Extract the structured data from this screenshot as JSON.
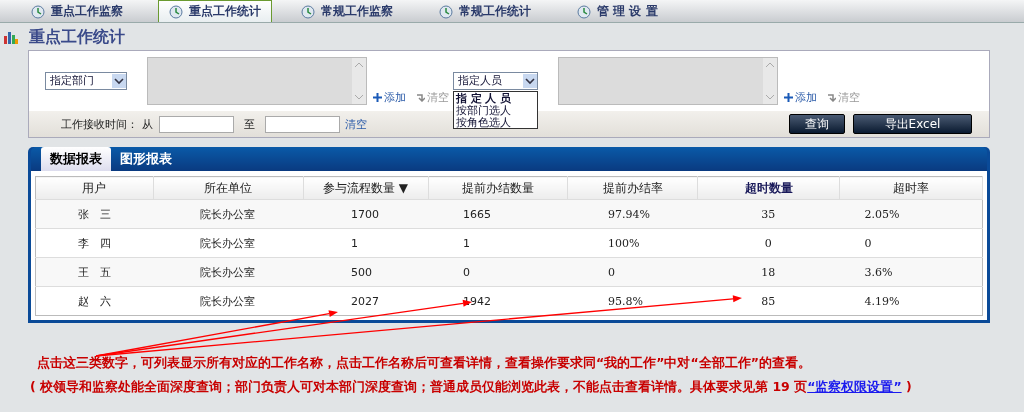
{
  "top_tabs": [
    {
      "label": "重点工作监察",
      "selected": false
    },
    {
      "label": "重点工作统计",
      "selected": true
    },
    {
      "label": "常规工作监察",
      "selected": false
    },
    {
      "label": "常规工作统计",
      "selected": false
    },
    {
      "label": "管 理 设 置",
      "selected": false
    }
  ],
  "page_title": "重点工作统计",
  "filters": {
    "pickers": [
      {
        "select": {
          "value": "指定部门"
        },
        "add": "添加",
        "clear": "清空"
      },
      {
        "select": {
          "value": "指定人员",
          "options": [
            {
              "label": "指 定 人 员",
              "selected": true
            },
            {
              "label": "按部门选人",
              "selected": false
            },
            {
              "label": "按角色选人",
              "selected": false
            }
          ]
        },
        "add": "添加",
        "clear": "清空"
      }
    ],
    "time_label": "工作接收时间：",
    "from": "从",
    "to": "至",
    "clear": "清空",
    "buttons": [
      "查询",
      "导出Excel"
    ]
  },
  "report_tabs": [
    {
      "label": "数据报表",
      "selected": true
    },
    {
      "label": "图形报表",
      "selected": false
    }
  ],
  "table": {
    "columns": [
      {
        "label": "用户"
      },
      {
        "label": "所在单位"
      },
      {
        "label": "参与流程数量",
        "sort_mark": "▼"
      },
      {
        "label": "提前办结数量"
      },
      {
        "label": "提前办结率"
      },
      {
        "label": "超时数量",
        "highlighted": true
      },
      {
        "label": "超时率"
      }
    ],
    "rows": [
      [
        "张　三",
        "院长办公室",
        "1700",
        "1665",
        "97.94%",
        "35",
        "2.05%"
      ],
      [
        "李　四",
        "院长办公室",
        "1",
        "1",
        "100%",
        "0",
        "0"
      ],
      [
        "王　五",
        "院长办公室",
        "500",
        "0",
        "0",
        "18",
        "3.6%"
      ],
      [
        "赵　六",
        "院长办公室",
        "2027",
        "1942",
        "95.8%",
        "85",
        "4.19%"
      ]
    ]
  },
  "notes": [
    {
      "text": "点击这三类数字，可列表显示所有对应的工作名称，点击工作名称后可查看详情，查看操作要求同“我的工作”中对“全部工作”的查看。"
    },
    {
      "text": "(  校领导和监察处能全面深度查询；部门负责人可对本部门深度查询；普通成员仅能浏览此表，不能点击查看详情。具体要求见第 19 页",
      "link": "“监察权限设置”",
      "after": ")"
    }
  ]
}
